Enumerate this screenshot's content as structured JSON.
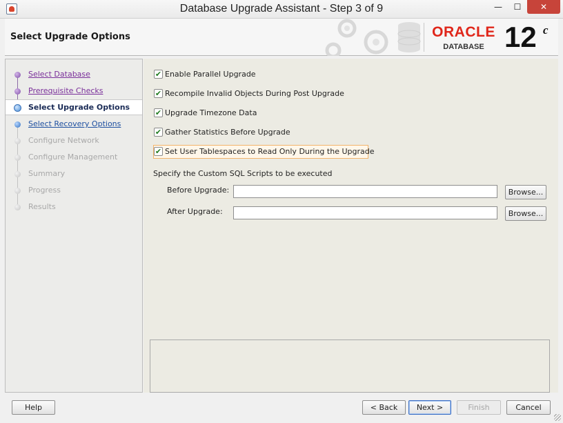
{
  "window": {
    "title": "Database Upgrade Assistant - Step 3 of 9",
    "min_glyph": "—",
    "max_glyph": "☐",
    "close_glyph": "✕"
  },
  "header": {
    "page_title": "Select Upgrade Options",
    "brand": "ORACLE",
    "brand_sub": "DATABASE",
    "version": "12",
    "version_suffix": "c",
    "brand_color": "#e0261a"
  },
  "steps": [
    {
      "label": "Select Database",
      "state": "visited"
    },
    {
      "label": "Prerequisite Checks",
      "state": "visited"
    },
    {
      "label": "Select Upgrade Options",
      "state": "current"
    },
    {
      "label": "Select Recovery Options",
      "state": "next"
    },
    {
      "label": "Configure Network",
      "state": "disabled"
    },
    {
      "label": "Configure Management",
      "state": "disabled"
    },
    {
      "label": "Summary",
      "state": "disabled"
    },
    {
      "label": "Progress",
      "state": "disabled"
    },
    {
      "label": "Results",
      "state": "disabled"
    }
  ],
  "options": [
    {
      "label": "Enable Parallel Upgrade",
      "checked": true
    },
    {
      "label": "Recompile Invalid Objects During Post Upgrade",
      "checked": true
    },
    {
      "label": "Upgrade Timezone Data",
      "checked": true
    },
    {
      "label": "Gather Statistics Before Upgrade",
      "checked": true
    },
    {
      "label": "Set User Tablespaces to Read Only During the Upgrade",
      "checked": true
    }
  ],
  "scripts": {
    "section_label": "Specify the Custom SQL Scripts to be executed",
    "before_label": "Before Upgrade:",
    "before_value": "",
    "after_label": "After Upgrade:",
    "after_value": "",
    "browse_label": "Browse..."
  },
  "footer": {
    "help": "Help",
    "back": "< Back",
    "next": "Next >",
    "finish": "Finish",
    "cancel": "Cancel"
  },
  "icons": {
    "check": "✔"
  }
}
